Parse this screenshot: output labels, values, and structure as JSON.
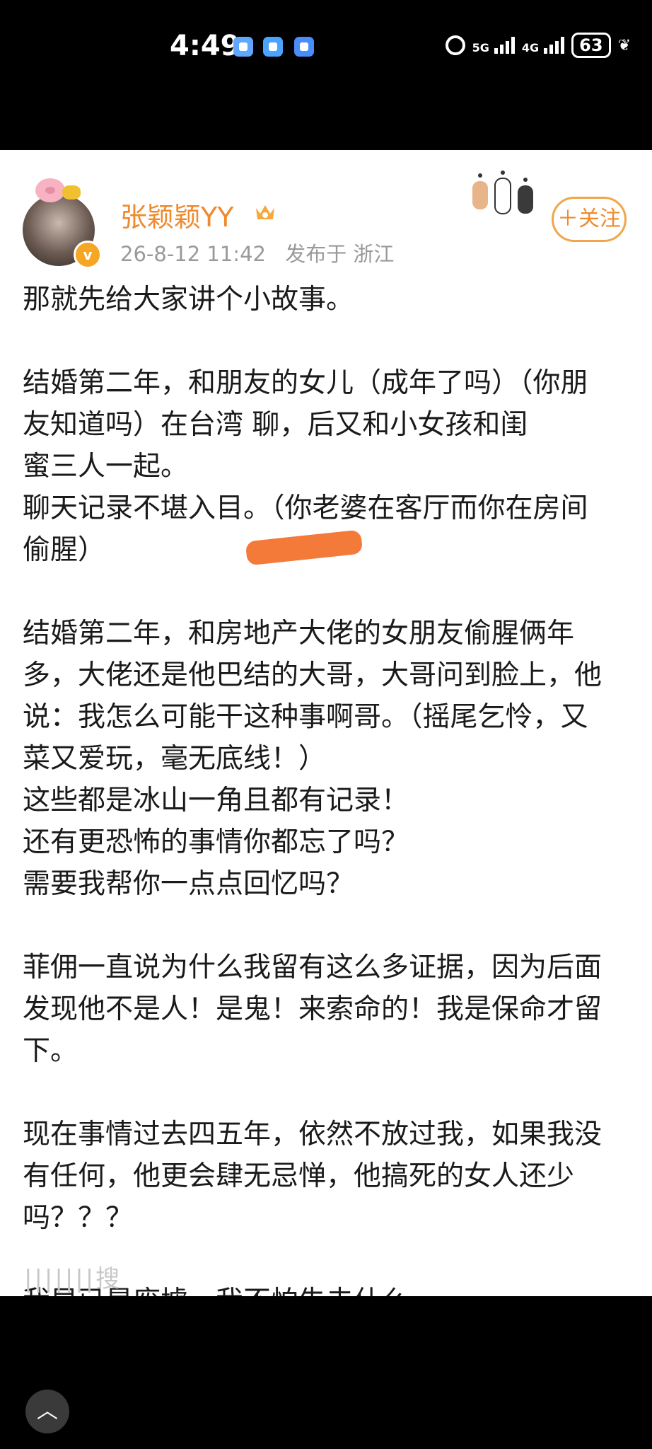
{
  "status_bar": {
    "time": "4:49",
    "net1": "5G",
    "net2": "4G",
    "battery": "63"
  },
  "post": {
    "username": "张颖颖YY",
    "timestamp": "26-8-12 11:42",
    "location": "发布于 浙江",
    "follow_label": "＋关注",
    "verified_badge": "v",
    "paragraphs": [
      [
        "那就先给大家讲个小故事。"
      ],
      [
        "结婚第二年，和朋友的女儿（成年了吗）（你朋",
        "友知道吗）在台湾                 聊，后又和小女孩和闺",
        "蜜三人一起。",
        "聊天记录不堪入目。（你老婆在客厅而你在房间",
        "偷腥）"
      ],
      [
        "结婚第二年，和房地产大佬的女朋友偷腥俩年",
        "多，大佬还是他巴结的大哥，大哥问到脸上，他",
        "说：我怎么可能干这种事啊哥。（摇尾乞怜，又",
        "菜又爱玩，毫无底线！）",
        "这些都是冰山一角且都有记录！",
        "还有更恐怖的事情你都忘了吗？",
        "需要我帮你一点点回忆吗？"
      ],
      [
        "菲佣一直说为什么我留有这么多证据，因为后面",
        "发现他不是人！是鬼！来索命的！我是保命才留",
        "下。"
      ],
      [
        "现在事情过去四五年，依然不放过我，如果我没",
        "有任何，他更会肆无忌惮，他搞死的女人还少",
        "吗？？？"
      ],
      [
        "我早已是废墟，我不怕失去什么。"
      ]
    ],
    "footer_blur": "|||||||搜"
  },
  "nav": {
    "up_icon": "︿"
  },
  "colors": {
    "accent": "#ef8a2e",
    "meta": "#999999",
    "redaction": "#f47a3a"
  }
}
